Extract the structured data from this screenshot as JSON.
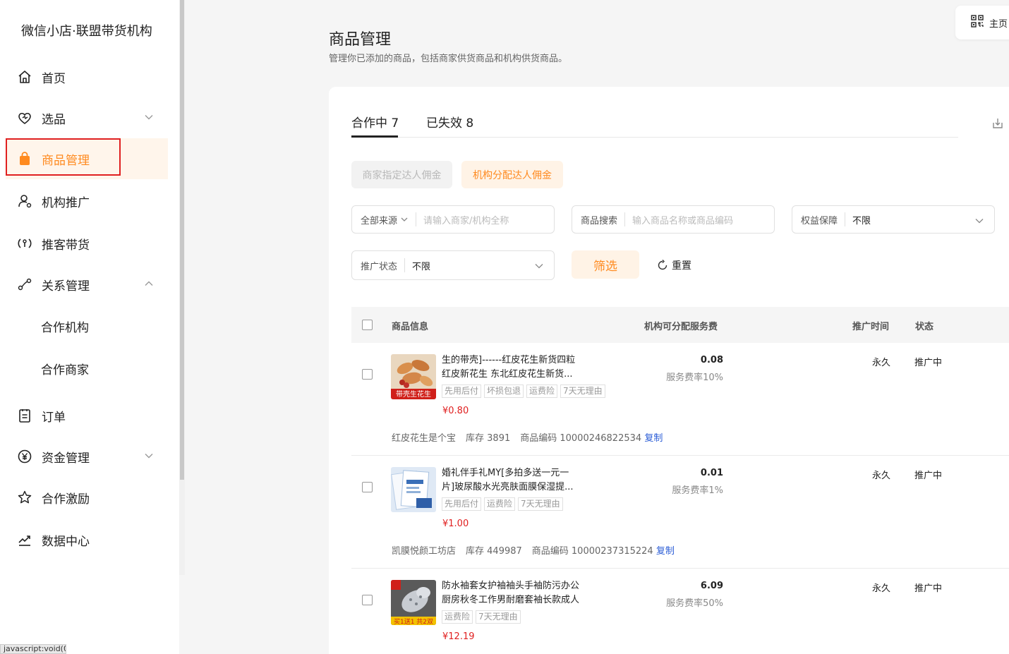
{
  "sidebar": {
    "brand": "微信小店·联盟带货机构",
    "items": [
      {
        "label": "首页",
        "icon": "home-icon"
      },
      {
        "label": "选品",
        "icon": "heart-tag-icon"
      },
      {
        "label": "商品管理",
        "icon": "shopping-bag-icon"
      },
      {
        "label": "机构推广",
        "icon": "user-promote-icon"
      },
      {
        "label": "推客带货",
        "icon": "promoter-icon"
      },
      {
        "label": "关系管理",
        "icon": "relation-icon"
      },
      {
        "label": "订单",
        "icon": "order-icon"
      },
      {
        "label": "资金管理",
        "icon": "yuan-icon"
      },
      {
        "label": "合作激励",
        "icon": "star-icon"
      },
      {
        "label": "数据中心",
        "icon": "chart-line-icon"
      }
    ],
    "sub_items": [
      "合作机构",
      "合作商家"
    ],
    "status_url": "javascript:void(0);"
  },
  "header": {
    "title": "商品管理",
    "description": "管理你已添加的商品，包括商家供货商品和机构供货商品。",
    "home_label": "主页"
  },
  "tabs": [
    {
      "label": "合作中 7"
    },
    {
      "label": "已失效 8"
    }
  ],
  "commission": {
    "merchant_label": "商家指定达人佣金",
    "agency_label": "机构分配达人佣金"
  },
  "filters": {
    "source_label": "全部来源",
    "source_placeholder": "请输入商家/机构全称",
    "search_label": "商品搜索",
    "search_placeholder": "输入商品名称或商品编码",
    "rights_label": "权益保障",
    "rights_value": "不限",
    "status_label": "推广状态",
    "status_value": "不限",
    "filter_button": "筛选",
    "reset_button": "重置"
  },
  "table": {
    "headers": {
      "info": "商品信息",
      "fee": "机构可分配服务费",
      "time": "推广时间",
      "status": "状态"
    },
    "rows": [
      {
        "title_line1": "生的带壳]------红皮花生新货四粒",
        "title_line2": "红皮新花生 东北红皮花生新货...",
        "tags": [
          "先用后付",
          "坏损包退",
          "运费险",
          "7天无理由"
        ],
        "price": "¥0.80",
        "fee": "0.08",
        "rate": "服务费率10%",
        "time": "永久",
        "status": "推广中",
        "shop": "红皮花生是个宝",
        "stock": "库存 3891",
        "code": "商品编码 10000246822534",
        "copy": "复制",
        "thumb_text": "带壳生花生"
      },
      {
        "title_line1": "婚礼伴手礼MY[多拍多送一元一",
        "title_line2": "片]玻尿酸水光亮肤面膜保湿提...",
        "tags": [
          "先用后付",
          "运费险",
          "7天无理由"
        ],
        "price": "¥1.00",
        "fee": "0.01",
        "rate": "服务费率1%",
        "time": "永久",
        "status": "推广中",
        "shop": "凯膜悦颜工坊店",
        "stock": "库存 449987",
        "code": "商品编码 10000237315224",
        "copy": "复制",
        "thumb_text": ""
      },
      {
        "title_line1": "防水袖套女护袖袖头手袖防污办公",
        "title_line2": "厨房秋冬工作男耐磨套袖长款成人",
        "tags": [
          "运费险",
          "7天无理由"
        ],
        "price": "¥12.19",
        "fee": "6.09",
        "rate": "服务费率50%",
        "time": "永久",
        "status": "推广中",
        "thumb_text": "买1送1 共2双"
      }
    ]
  },
  "colors": {
    "accent": "#ff8a1f",
    "accent_bg": "#fff3e6",
    "price_red": "#e02020",
    "link_blue": "#2b5dd6",
    "highlight_red": "#e02020"
  }
}
